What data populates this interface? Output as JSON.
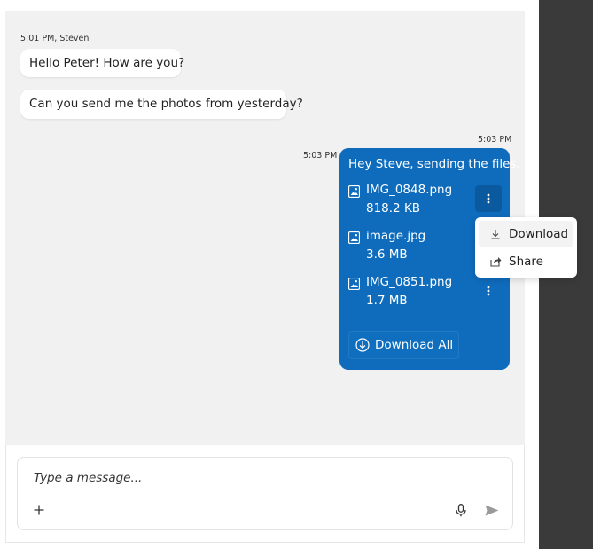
{
  "messages": [
    {
      "meta": "5:01 PM, Steven",
      "text": "Hello Peter! How are you?"
    },
    {
      "text": "Can you send me the photos from yesterday?"
    }
  ],
  "outgoing": {
    "meta_top": "5:03 PM",
    "meta_side": "5:03 PM",
    "text": "Hey Steve, sending the files.",
    "files": [
      {
        "name": "IMG_0848.png",
        "size": "818.2 KB"
      },
      {
        "name": "image.jpg",
        "size": "3.6 MB"
      },
      {
        "name": "IMG_0851.png",
        "size": "1.7 MB"
      }
    ],
    "download_all_label": "Download All"
  },
  "context_menu": {
    "items": [
      {
        "label": "Download",
        "icon": "download-icon"
      },
      {
        "label": "Share",
        "icon": "share-icon"
      }
    ]
  },
  "composer": {
    "placeholder": "Type a message...",
    "add_icon": "plus-icon",
    "mic_icon": "microphone-icon",
    "send_icon": "send-icon"
  },
  "colors": {
    "bubble_out": "#0f6cbd",
    "chat_bg": "#f1f1f1",
    "side_panel": "#3a3a3a"
  }
}
